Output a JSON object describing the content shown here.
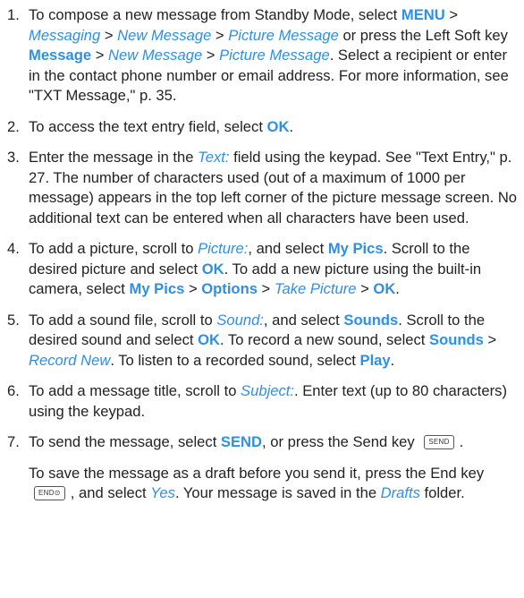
{
  "steps": [
    {
      "num": "1.",
      "parts": [
        {
          "t": "To compose a new message from Standby Mode, select "
        },
        {
          "t": "MENU",
          "s": "kw"
        },
        {
          "t": " > "
        },
        {
          "t": "Messaging",
          "s": "it"
        },
        {
          "t": " > "
        },
        {
          "t": "New Message",
          "s": "it"
        },
        {
          "t": " > "
        },
        {
          "t": "Picture Message",
          "s": "it"
        },
        {
          "t": " or press the Left Soft key "
        },
        {
          "t": "Message",
          "s": "kw"
        },
        {
          "t": " > "
        },
        {
          "t": "New Message",
          "s": "it"
        },
        {
          "t": " > "
        },
        {
          "t": "Picture Message",
          "s": "it"
        },
        {
          "t": ". Select a recipient or enter in the contact phone number or email address. For more information, see \"TXT Message,\" p. 35."
        }
      ]
    },
    {
      "num": "2.",
      "parts": [
        {
          "t": "To access the text entry field, select "
        },
        {
          "t": "OK",
          "s": "kw"
        },
        {
          "t": "."
        }
      ]
    },
    {
      "num": "3.",
      "parts": [
        {
          "t": "Enter the message in the "
        },
        {
          "t": "Text:",
          "s": "it"
        },
        {
          "t": " field using the keypad. See \"Text Entry,\" p. 27. The number of characters used (out of a maximum of 1000 per message) appears in the top left corner of the picture message screen. No additional text can be entered when all characters have been used."
        }
      ]
    },
    {
      "num": "4.",
      "parts": [
        {
          "t": "To add a picture, scroll to "
        },
        {
          "t": "Picture:",
          "s": "it"
        },
        {
          "t": ", and select "
        },
        {
          "t": "My Pics",
          "s": "kw"
        },
        {
          "t": ". Scroll to the desired picture and select "
        },
        {
          "t": "OK",
          "s": "kw"
        },
        {
          "t": ". To add a new picture using the built-in camera, select "
        },
        {
          "t": "My Pics",
          "s": "kw"
        },
        {
          "t": " > "
        },
        {
          "t": "Options",
          "s": "kw"
        },
        {
          "t": " > "
        },
        {
          "t": "Take Picture",
          "s": "it"
        },
        {
          "t": " > "
        },
        {
          "t": "OK",
          "s": "kw"
        },
        {
          "t": "."
        }
      ]
    },
    {
      "num": "5.",
      "parts": [
        {
          "t": "To add a sound file, scroll to "
        },
        {
          "t": "Sound:",
          "s": "it"
        },
        {
          "t": ", and select "
        },
        {
          "t": "Sounds",
          "s": "kw"
        },
        {
          "t": ". Scroll to the desired sound and select "
        },
        {
          "t": "OK",
          "s": "kw"
        },
        {
          "t": ". To record a new sound, select "
        },
        {
          "t": "Sounds",
          "s": "kw"
        },
        {
          "t": " > "
        },
        {
          "t": "Record New",
          "s": "it"
        },
        {
          "t": ". To listen to a recorded sound, select "
        },
        {
          "t": "Play",
          "s": "kw"
        },
        {
          "t": "."
        }
      ]
    },
    {
      "num": "6.",
      "parts": [
        {
          "t": "To add a message title, scroll to "
        },
        {
          "t": "Subject:",
          "s": "it"
        },
        {
          "t": ". Enter text (up to 80 characters) using the keypad."
        }
      ]
    },
    {
      "num": "7.",
      "parts": [
        {
          "t": "To send the message, select "
        },
        {
          "t": "SEND",
          "s": "kw"
        },
        {
          "t": ", or press the Send key "
        },
        {
          "t": "SEND",
          "s": "key",
          "icon": "send-key-icon"
        },
        {
          "t": "."
        }
      ],
      "note": [
        {
          "t": "To save the message as a draft before you send it, press the End key "
        },
        {
          "t": "END⊙",
          "s": "key",
          "icon": "end-key-icon"
        },
        {
          "t": ", and select "
        },
        {
          "t": "Yes",
          "s": "it"
        },
        {
          "t": ". Your message is saved in the "
        },
        {
          "t": "Drafts",
          "s": "it"
        },
        {
          "t": " folder."
        }
      ]
    }
  ],
  "colors": {
    "accent": "#2f8fe0",
    "text": "#222222"
  }
}
